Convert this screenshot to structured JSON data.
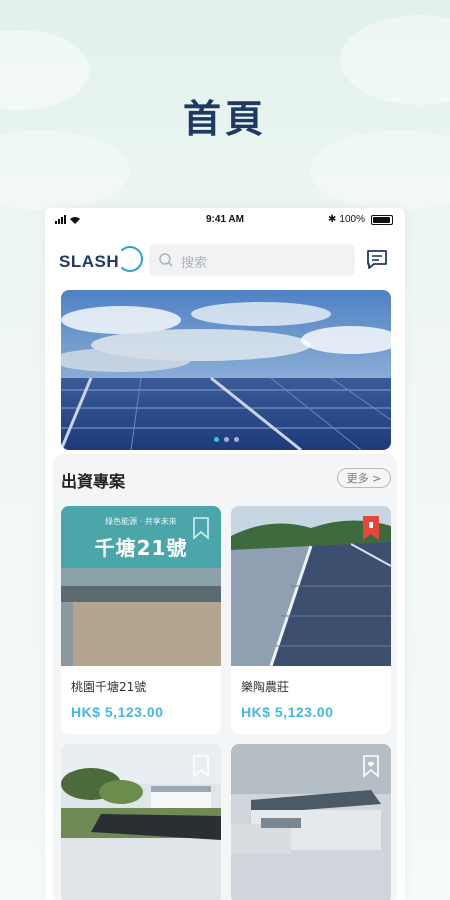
{
  "page_heading": "首頁",
  "status_bar": {
    "time": "9:41 AM",
    "battery": "100%"
  },
  "header": {
    "logo_text": "SLASH",
    "search_placeholder": "搜索"
  },
  "banner": {
    "dots": 3,
    "active_dot": 1
  },
  "section": {
    "title": "出資專案",
    "more_label": "更多 >"
  },
  "projects": [
    {
      "name": "桃園千塘21號",
      "price": "HK$ 5,123.00",
      "image_overlay_title": "千塘21號",
      "image_overlay_subtitle": "綠色能源 · 共享未來",
      "bookmarked": false
    },
    {
      "name": "樂陶農莊",
      "price": "HK$ 5,123.00",
      "bookmarked": true
    },
    {
      "name": "",
      "price": "",
      "bookmarked": false
    },
    {
      "name": "",
      "price": "",
      "bookmarked": false
    }
  ],
  "colors": {
    "heading": "#1e3a64",
    "price": "#46b7e0",
    "bookmark_active": "#e5473d",
    "accent": "#38c7d8"
  }
}
